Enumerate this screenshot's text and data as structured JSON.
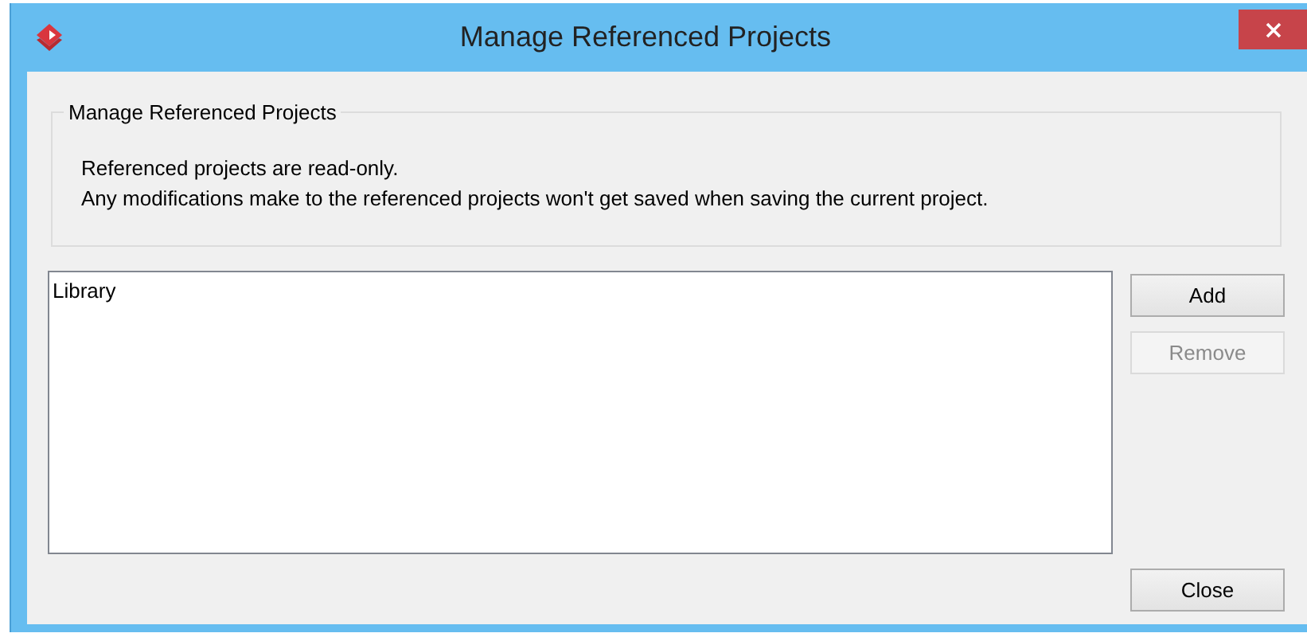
{
  "window": {
    "title": "Manage Referenced Projects"
  },
  "group": {
    "title": "Manage Referenced Projects",
    "lines": [
      "Referenced projects are read-only.",
      "Any modifications make to the referenced projects won't get saved when saving the current project."
    ]
  },
  "projects": [
    {
      "label": "Library",
      "selected": false
    }
  ],
  "side_buttons": [
    {
      "label": "Add",
      "disabled": false
    },
    {
      "label": "Remove",
      "disabled": true
    }
  ],
  "close_button": {
    "label": "Close",
    "disabled": false
  }
}
